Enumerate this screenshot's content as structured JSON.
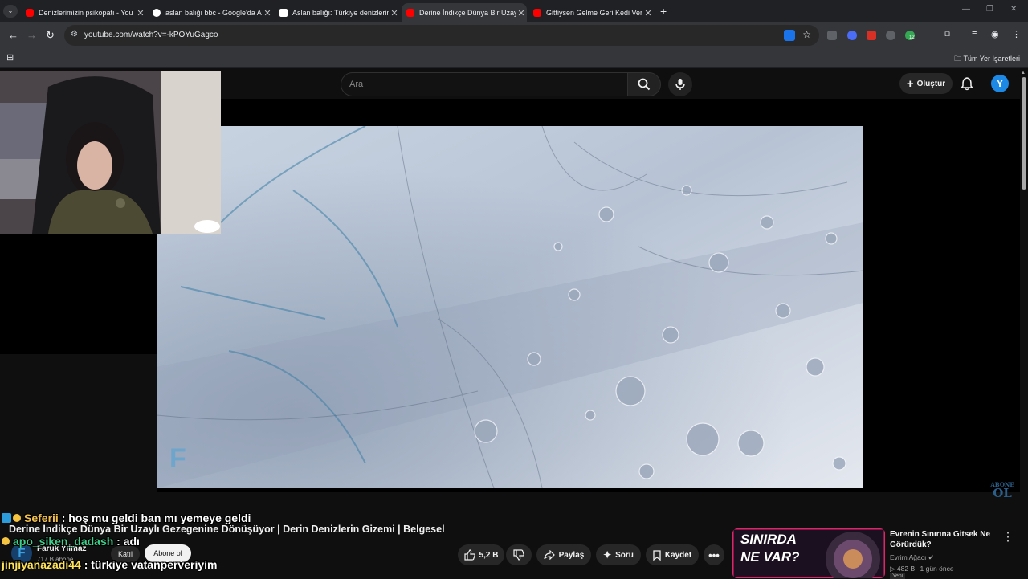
{
  "browser": {
    "tabs": [
      {
        "title": "Denizlerimizin psikopatı - You",
        "favicon_color": "#ff0000",
        "active": false
      },
      {
        "title": "aslan balığı bbc - Google'da Ar",
        "favicon_color": "#ffffff",
        "active": false
      },
      {
        "title": "Aslan balığı: Türkiye denizlerin",
        "favicon_color": "#ffffff",
        "active": false
      },
      {
        "title": "Derine İndikçe Dünya Bir Uzaylı",
        "favicon_color": "#ff0000",
        "active": true
      },
      {
        "title": "Gittiysen Gelme Geri Kedi Versi",
        "favicon_color": "#ff0000",
        "active": false
      }
    ],
    "url": "youtube.com/watch?v=-kPOYuGagco",
    "bookmarks_label": "Tüm Yer İşaretleri",
    "extension_badge": "12"
  },
  "youtube": {
    "search_placeholder": "Ara",
    "create_label": "Oluştur",
    "avatar_letter": "Y"
  },
  "overlay": {
    "abone_top": "ABONE",
    "abone_bottom": "OL",
    "watermark": "F"
  },
  "video": {
    "title": "Derine İndikçe Dünya Bir Uzaylı Gezegenine Dönüşüyor | Derin Denizlerin Gizemi | Belgesel",
    "channel": "Faruk Yılmaz",
    "subscribers": "717 B abone",
    "join_label": "Katıl",
    "subscribe_label": "Abone ol",
    "likes": "5,2 B",
    "share_label": "Paylaş",
    "ask_label": "Soru",
    "save_label": "Kaydet"
  },
  "chat": [
    {
      "user": "Seferii",
      "message": ": hoş mu geldi ban mı yemeye geldi"
    },
    {
      "user": "apo_siken_dadash",
      "message": ": adı"
    },
    {
      "user": "jinjiyanazadi44",
      "message": ": türkiye vatanperveriyim"
    }
  ],
  "recommendation": {
    "thumb_text_1": "SINIRDA",
    "thumb_text_2": "NE VAR?",
    "title": "Evrenin Sınırına Gitsek Ne Görürdük?",
    "channel": "Evrim Ağacı",
    "views": "482 B",
    "age": "1 gün önce",
    "badge": "Yeni"
  }
}
